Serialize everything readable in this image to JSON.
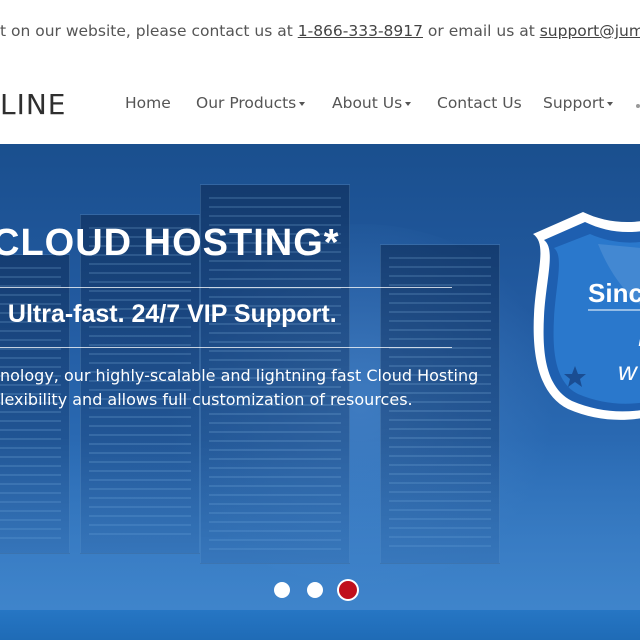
{
  "topbar": {
    "prefix": "t on our website, please contact us at ",
    "phone": "1-866-333-8917",
    "middle": " or email us at ",
    "email": "support@jumpline.com"
  },
  "logo": {
    "text": "LINE"
  },
  "nav": {
    "items": [
      {
        "label": "Home",
        "dropdown": false
      },
      {
        "label": "Our Products",
        "dropdown": true
      },
      {
        "label": "About Us",
        "dropdown": true
      },
      {
        "label": "Contact Us",
        "dropdown": false
      },
      {
        "label": "Support",
        "dropdown": true
      }
    ]
  },
  "hero": {
    "title": "CLOUD HOSTING*",
    "subtitle": ". Ultra-fast. 24/7 VIP Support.",
    "desc_line1": "nology, our highly-scalable and lightning fast Cloud Hosting",
    "desc_line2": "lexibility and allows full customization of resources.",
    "badge_line1": "Sinc",
    "badge_line2": "N",
    "badge_line3": "w",
    "badge_line4": "/"
  },
  "carousel": {
    "slide_count": 3,
    "active_index": 2
  },
  "colors": {
    "hero_blue": "#225aa0",
    "active_dot": "#c0101c",
    "badge_blue": "#1e5fb0"
  }
}
